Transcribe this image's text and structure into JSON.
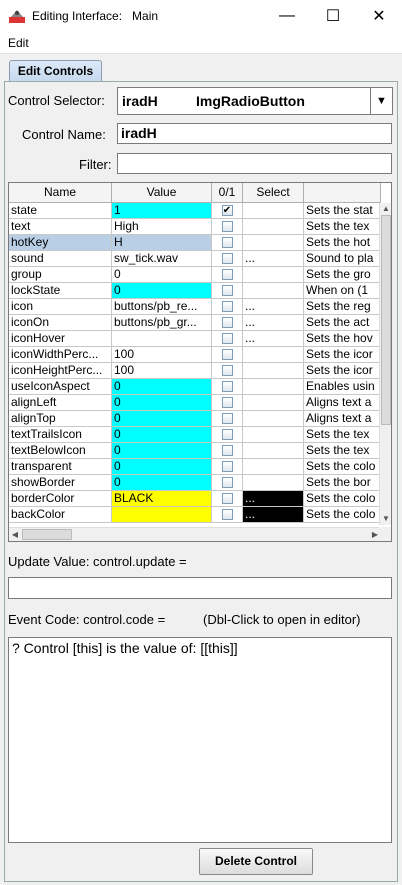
{
  "window": {
    "title": "Editing Interface:   Main",
    "minimize_icon": "minimize-icon",
    "maximize_icon": "maximize-icon",
    "close_icon": "close-icon"
  },
  "menu": {
    "edit": "Edit"
  },
  "tabs": [
    {
      "label": "Edit Controls"
    }
  ],
  "selector": {
    "label": "Control Selector:",
    "name": "iradH",
    "type": "ImgRadioButton"
  },
  "control_name": {
    "label": "Control Name:",
    "value": "iradH"
  },
  "filter": {
    "label": "Filter:",
    "value": ""
  },
  "table": {
    "columns": [
      "Name",
      "Value",
      "0/1",
      "Select",
      ""
    ],
    "rows": [
      {
        "name": "state",
        "value": "1",
        "check": "✔",
        "select": "",
        "desc": "Sets the stat",
        "bg": "#00ffff"
      },
      {
        "name": "text",
        "value": "High",
        "check": "",
        "select": "",
        "desc": "Sets the tex",
        "bg": ""
      },
      {
        "name": "hotKey",
        "value": "H",
        "check": "",
        "select": "",
        "desc": "Sets the hot",
        "bg": "",
        "selected": true
      },
      {
        "name": "sound",
        "value": "sw_tick.wav",
        "check": "",
        "select": "...",
        "desc": "Sound to pla",
        "bg": ""
      },
      {
        "name": "group",
        "value": "0",
        "check": "",
        "select": "",
        "desc": "Sets the gro",
        "bg": ""
      },
      {
        "name": "lockState",
        "value": "0",
        "check": "",
        "select": "",
        "desc": "When on (1",
        "bg": "#00ffff"
      },
      {
        "name": "icon",
        "value": "buttons/pb_re...",
        "check": "",
        "select": "...",
        "desc": "Sets the reg",
        "bg": ""
      },
      {
        "name": "iconOn",
        "value": "buttons/pb_gr...",
        "check": "",
        "select": "...",
        "desc": "Sets the act",
        "bg": ""
      },
      {
        "name": "iconHover",
        "value": "",
        "check": "",
        "select": "...",
        "desc": "Sets the hov",
        "bg": ""
      },
      {
        "name": "iconWidthPerc...",
        "value": "100",
        "check": "",
        "select": "",
        "desc": "Sets the icor",
        "bg": ""
      },
      {
        "name": "iconHeightPerc...",
        "value": "100",
        "check": "",
        "select": "",
        "desc": "Sets the icor",
        "bg": ""
      },
      {
        "name": "useIconAspect",
        "value": "0",
        "check": "",
        "select": "",
        "desc": "Enables usin",
        "bg": "#00ffff"
      },
      {
        "name": "alignLeft",
        "value": "0",
        "check": "",
        "select": "",
        "desc": "Aligns text a",
        "bg": "#00ffff"
      },
      {
        "name": "alignTop",
        "value": "0",
        "check": "",
        "select": "",
        "desc": "Aligns text a",
        "bg": "#00ffff"
      },
      {
        "name": "textTrailsIcon",
        "value": "0",
        "check": "",
        "select": "",
        "desc": "Sets the tex",
        "bg": "#00ffff"
      },
      {
        "name": "textBelowIcon",
        "value": "0",
        "check": "",
        "select": "",
        "desc": "Sets the tex",
        "bg": "#00ffff"
      },
      {
        "name": "transparent",
        "value": "0",
        "check": "",
        "select": "",
        "desc": "Sets the colo",
        "bg": "#00ffff"
      },
      {
        "name": "showBorder",
        "value": "0",
        "check": "",
        "select": "",
        "desc": "Sets the bor",
        "bg": "#00ffff"
      },
      {
        "name": "borderColor",
        "value": "BLACK",
        "check": "",
        "select": "...",
        "desc": "Sets the colo",
        "bg": "#ffff00",
        "select_bg": "#000000"
      },
      {
        "name": "backColor",
        "value": "",
        "check": "",
        "select": "...",
        "desc": "Sets the colo",
        "bg": "#ffff00",
        "select_bg": "#000000"
      }
    ]
  },
  "update": {
    "label": "Update Value: control.update =",
    "value": ""
  },
  "event": {
    "label": "Event Code: control.code =",
    "hint": "(Dbl-Click to open in editor)",
    "code": "? Control [this] is the value of: [[this]]"
  },
  "delete_button": "Delete Control"
}
